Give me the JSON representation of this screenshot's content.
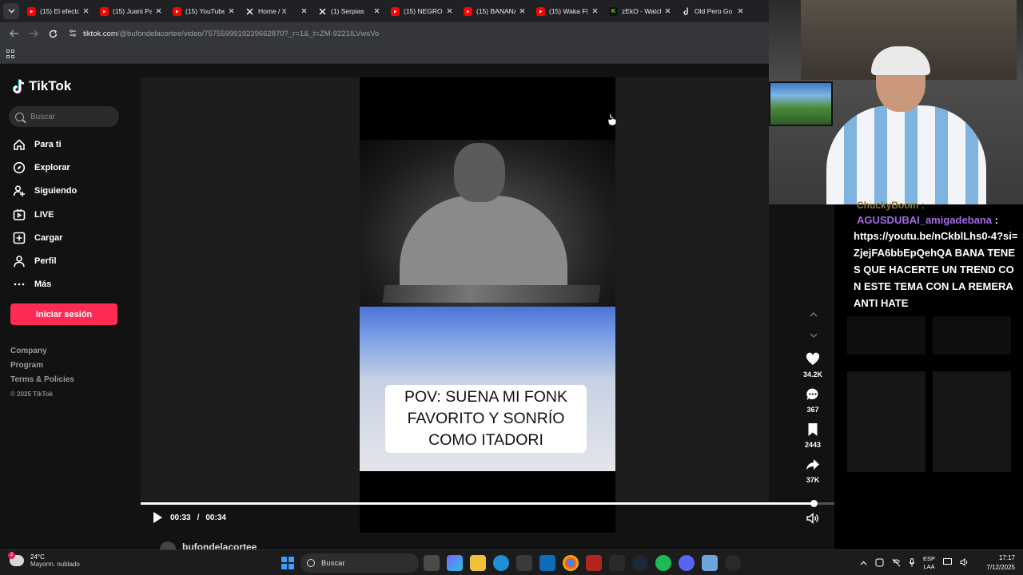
{
  "browser": {
    "tabs": [
      {
        "title": "(15) El efecto",
        "favicon": "youtube-icon",
        "color": "#ff0000"
      },
      {
        "title": "(15) Juani Pa",
        "favicon": "youtube-icon",
        "color": "#ff0000"
      },
      {
        "title": "(15) YouTube",
        "favicon": "youtube-icon",
        "color": "#ff0000"
      },
      {
        "title": "Home / X",
        "favicon": "x-icon",
        "color": "#ffffff"
      },
      {
        "title": "(1) Serpias",
        "favicon": "x-icon",
        "color": "#ffffff"
      },
      {
        "title": "(15) NEGRO",
        "favicon": "youtube-icon",
        "color": "#ff0000"
      },
      {
        "title": "(15) BANANA",
        "favicon": "youtube-icon",
        "color": "#ff0000"
      },
      {
        "title": "(15) Waka Fl",
        "favicon": "youtube-icon",
        "color": "#ff0000"
      },
      {
        "title": "zEkO - Watch",
        "favicon": "kick-icon",
        "color": "#53fc18"
      },
      {
        "title": "Old Pero Go",
        "favicon": "tiktok-icon",
        "color": "#ffffff"
      }
    ],
    "url_host": "tiktok.com",
    "url_path": "/@bufondelacortee/video/7575599919239662870?_r=1&_t=ZM-9221ILVwsVo"
  },
  "tiktok": {
    "logo": "TikTok",
    "search_placeholder": "Buscar",
    "nav": [
      {
        "label": "Para ti",
        "icon": "home-icon"
      },
      {
        "label": "Explorar",
        "icon": "compass-icon"
      },
      {
        "label": "Siguiendo",
        "icon": "following-icon"
      },
      {
        "label": "LIVE",
        "icon": "live-icon"
      },
      {
        "label": "Cargar",
        "icon": "upload-icon"
      },
      {
        "label": "Perfil",
        "icon": "profile-icon"
      },
      {
        "label": "Más",
        "icon": "more-icon"
      }
    ],
    "login_label": "Iniciar sesión",
    "footer": [
      "Company",
      "Program",
      "Terms & Policies"
    ],
    "copyright": "© 2025 TikTok",
    "video": {
      "caption_line1": "POV: SUENA MI FONK",
      "caption_line2": "FAVORITO Y SONRÍO",
      "caption_line3": "COMO ITADORI",
      "time_current": "00:33",
      "time_total": "00:34",
      "progress": 0.97
    },
    "actions": [
      {
        "icon": "heart-icon",
        "count": "34.2K"
      },
      {
        "icon": "comment-icon",
        "count": "367"
      },
      {
        "icon": "bookmark-icon",
        "count": "2443"
      },
      {
        "icon": "share-icon",
        "count": "37K"
      }
    ],
    "author": "bufondelacortee"
  },
  "stream_chat": {
    "prev_line": "ChuckyBoom :",
    "user": "AGUSDUBAI_amigadebana",
    "message": "https://youtu.be/nCkblLhs0-4?si=ZjejFA6bbEpQehQA BANA TENES QUE HACERTE UN TREND CON ESTE TEMA CON LA REMERA ANTI HATE",
    "user_color": "#a468e6"
  },
  "taskbar": {
    "weather_temp": "24°C",
    "weather_desc": "Mayorm. nublado",
    "weather_badge": "2",
    "search_label": "Buscar",
    "lang_line1": "ESP",
    "lang_line2": "LAA",
    "time": "17:17",
    "date": "7/12/2025"
  },
  "colors": {
    "accent": "#fe2c55",
    "background": "#121212"
  }
}
